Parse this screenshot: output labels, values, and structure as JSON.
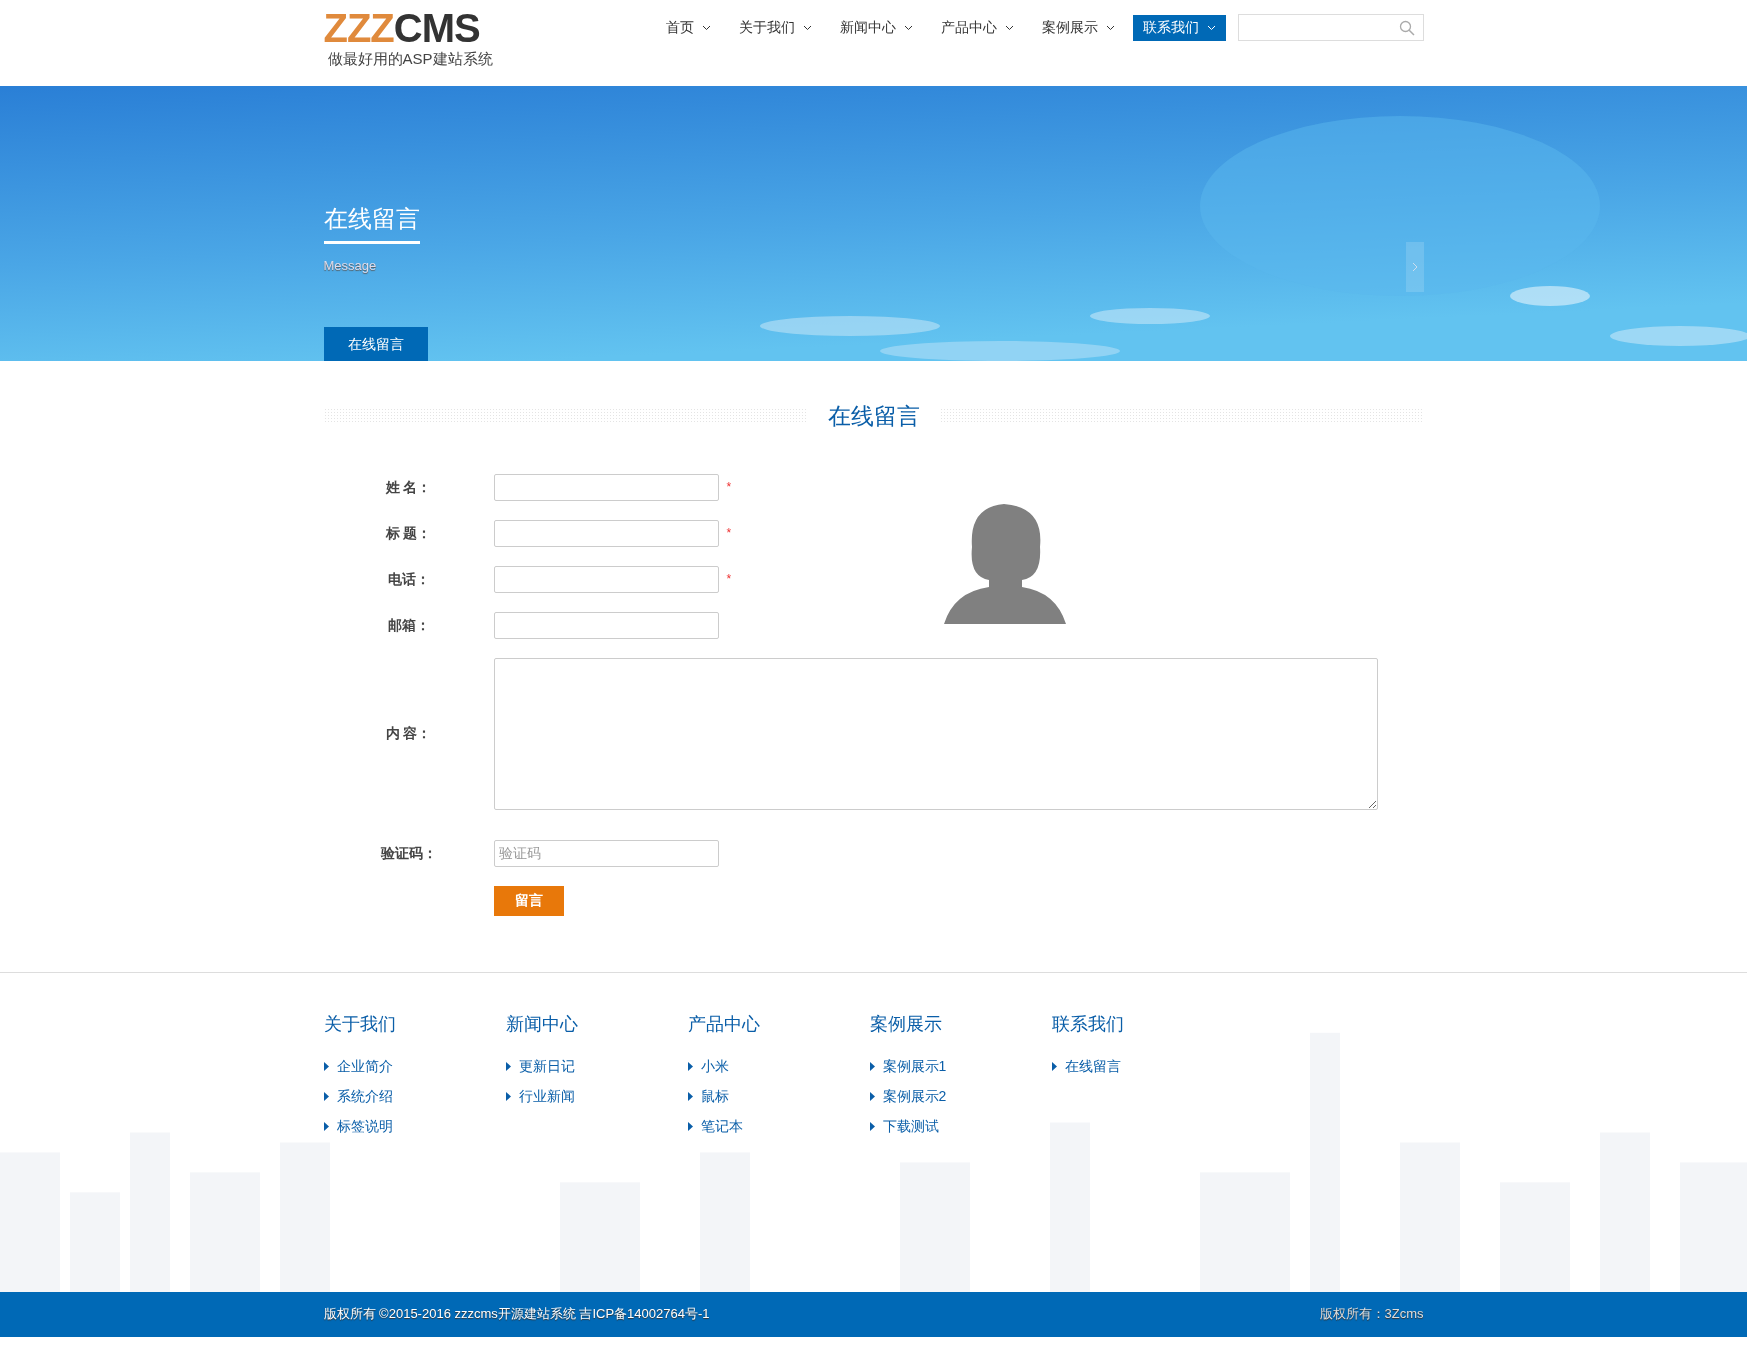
{
  "header": {
    "logo": {
      "part_1": "ZZZ",
      "part_2": "CMS",
      "tagline": "做最好用的ASP建站系统"
    },
    "nav": [
      {
        "label": "首页",
        "selected": false
      },
      {
        "label": "关于我们",
        "selected": false
      },
      {
        "label": "新闻中心",
        "selected": false
      },
      {
        "label": "产品中心",
        "selected": false
      },
      {
        "label": "案例展示",
        "selected": false
      },
      {
        "label": "联系我们",
        "selected": true
      }
    ]
  },
  "banner": {
    "title": "在线留言",
    "subtitle": "Message",
    "tabs": [
      {
        "label": "在线留言",
        "selected": true
      }
    ]
  },
  "section_title": "在线留言",
  "form": {
    "fields": [
      {
        "label": "姓 名：",
        "kind": "input",
        "mark": "*"
      },
      {
        "label": "标 题：",
        "kind": "input",
        "mark": "*"
      },
      {
        "label": "电话：",
        "kind": "input",
        "mark": "*"
      },
      {
        "label": "邮箱：",
        "kind": "input"
      },
      {
        "label": "内 容：",
        "kind": "textarea"
      },
      {
        "label": "验证码：",
        "kind": "input",
        "placeholder": "验证码"
      }
    ],
    "submit": "留言"
  },
  "footer": {
    "columns": [
      {
        "title": "关于我们",
        "links": [
          "企业简介",
          "系统介绍",
          "标签说明"
        ]
      },
      {
        "title": "新闻中心",
        "links": [
          "更新日记",
          "行业新闻"
        ]
      },
      {
        "title": "产品中心",
        "links": [
          "小米",
          "鼠标",
          "笔记本"
        ]
      },
      {
        "title": "案例展示",
        "links": [
          "案例展示1",
          "案例展示2",
          "下载测试"
        ]
      },
      {
        "title": "联系我们",
        "links": [
          "在线留言"
        ]
      }
    ],
    "copyright": "版权所有 ©2015-2016 zzzcms开源建站系统 吉ICP备14002764号-1",
    "right_text": "版权所有：3Zcms"
  }
}
